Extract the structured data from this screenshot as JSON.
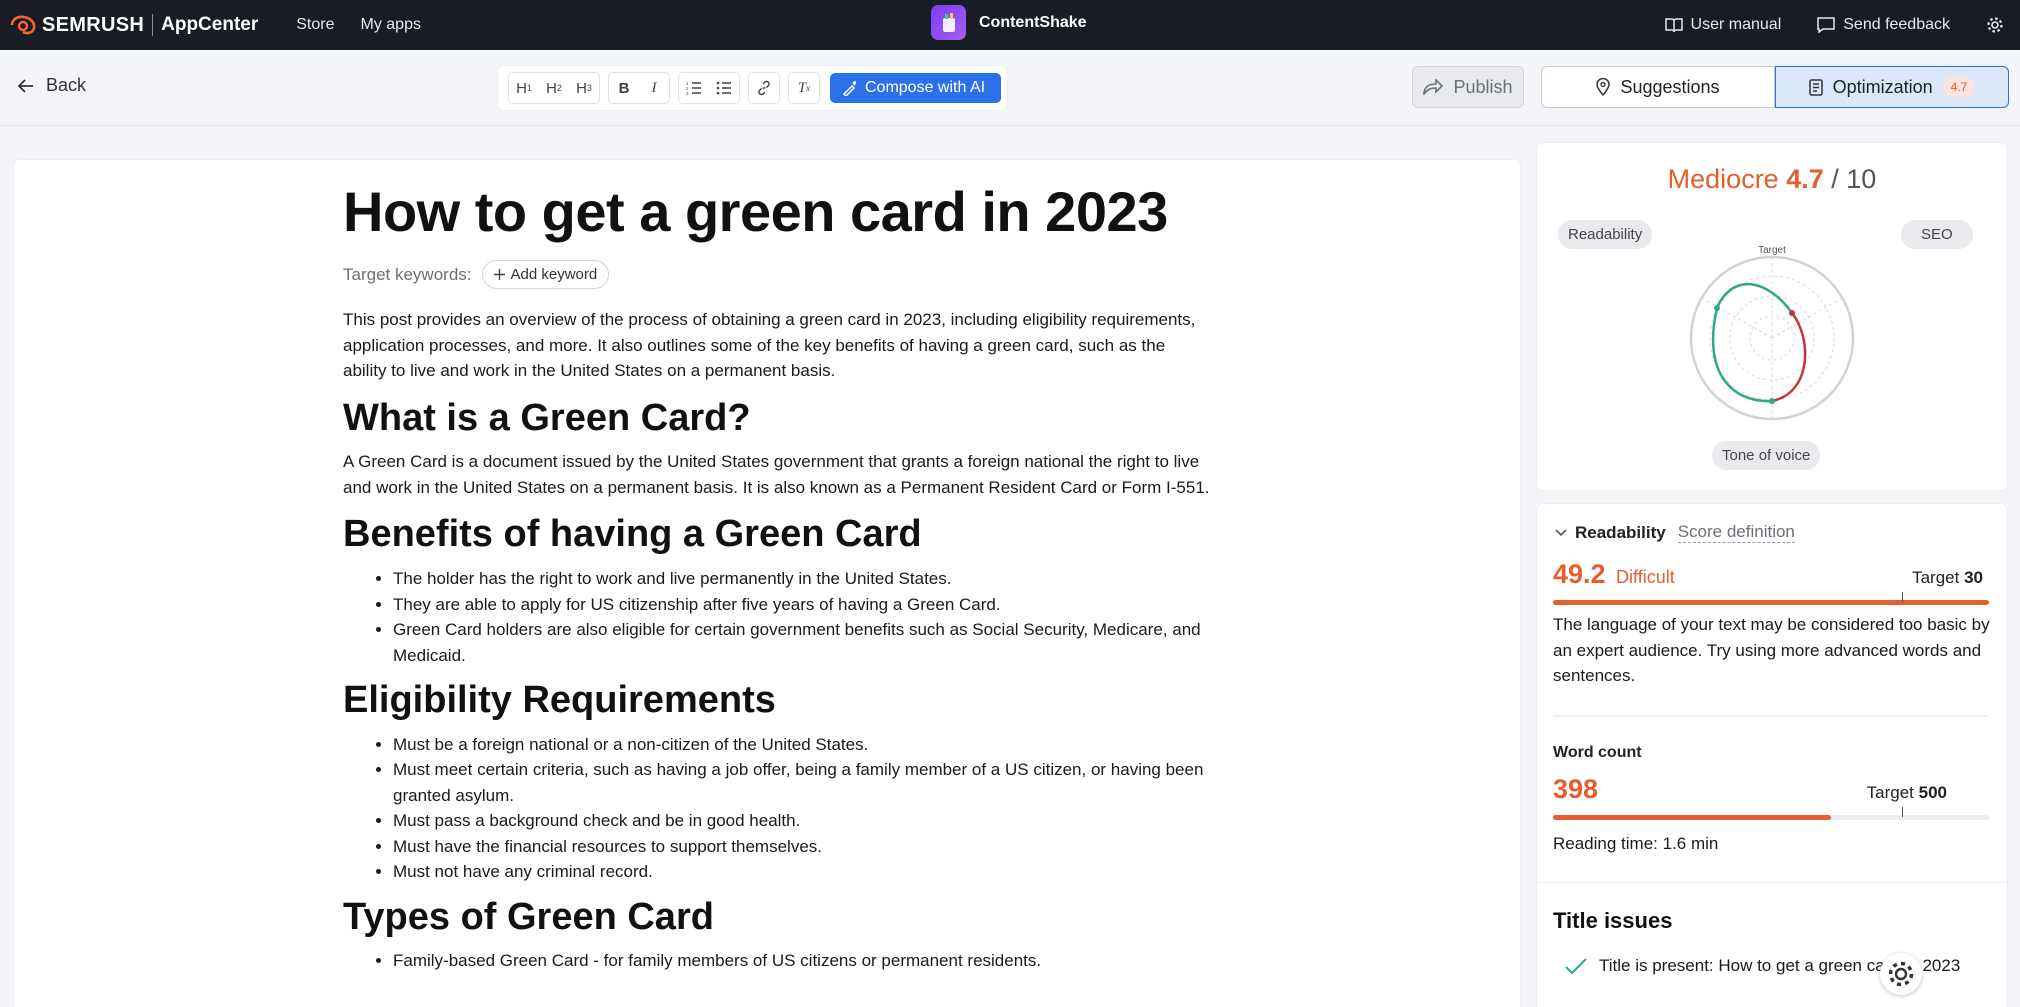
{
  "topbar": {
    "brand": "SEMRUSH",
    "app_center": "AppCenter",
    "nav": [
      "Store",
      "My apps"
    ],
    "app_name": "ContentShake",
    "user_manual": "User manual",
    "send_feedback": "Send feedback"
  },
  "toolbar": {
    "back": "Back",
    "compose": "Compose with AI",
    "publish": "Publish",
    "tabs": {
      "suggestions": "Suggestions",
      "optimization": "Optimization",
      "optimization_badge": "4.7"
    }
  },
  "document": {
    "title": "How to get a green card in 2023",
    "keywords_label": "Target keywords:",
    "add_keyword": "Add keyword",
    "intro": "This post provides an overview of the process of obtaining a green card in 2023, including eligibility requirements, application processes, and more. It also outlines some of the key benefits of having a green card, such as the ability to live and work in the United States on a permanent basis.",
    "s1_heading": "What is a Green Card?",
    "s1_text": "A Green Card is a document issued by the United States government that grants a foreign national the right to live and work in the United States on a permanent basis. It is also known as a Permanent Resident Card or Form I-551.",
    "s2_heading": "Benefits of having a Green Card",
    "s2_items": [
      "The holder has the right to work and live permanently in the United States.",
      "They are able to apply for US citizenship after five years of having a Green Card.",
      "Green Card holders are also eligible for certain government benefits such as Social Security, Medicare, and Medicaid."
    ],
    "s3_heading": "Eligibility Requirements",
    "s3_items": [
      "Must be a foreign national or a non-citizen of the United States.",
      "Must meet certain criteria, such as having a job offer, being a family member of a US citizen, or having been granted asylum.",
      "Must pass a background check and be in good health.",
      "Must have the financial resources to support themselves.",
      "Must not have any criminal record."
    ],
    "s4_heading": "Types of Green Card",
    "s4_items": [
      "Family-based Green Card - for family members of US citizens or permanent residents."
    ]
  },
  "score": {
    "label": "Mediocre",
    "value": "4.7",
    "max": "/ 10",
    "pill_readability": "Readability",
    "pill_seo": "SEO",
    "pill_tone": "Tone of voice",
    "radar_target": "Target"
  },
  "readability": {
    "title": "Readability",
    "link": "Score definition",
    "value": "49.2",
    "verdict": "Difficult",
    "target_label": "Target",
    "target_value": "30",
    "progress": 1.0,
    "target_fraction": 0.8,
    "description": "The language of your text may be considered too basic by an expert audience. Try using more advanced words and sentences."
  },
  "word_count": {
    "label": "Word count",
    "value": "398",
    "target_label": "Target",
    "target_value": "500",
    "progress": 0.638,
    "target_fraction": 0.8,
    "reading_time": "Reading time: 1.6 min"
  },
  "title_issues": {
    "heading": "Title issues",
    "item": "Title is present: How to get a green card in 2023"
  },
  "colors": {
    "accent": "#e55e2e",
    "primary": "#2b72e6",
    "topbar": "#181c24"
  }
}
